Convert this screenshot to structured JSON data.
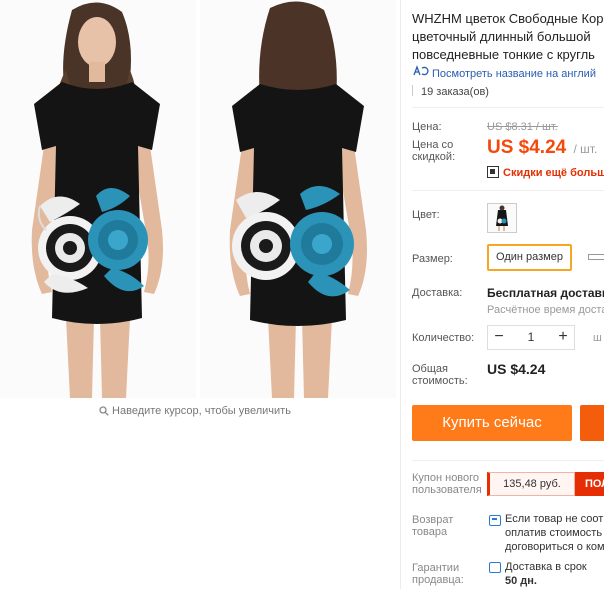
{
  "gallery": {
    "zoom_hint": "Наведите курсор, чтобы увеличить"
  },
  "product": {
    "title_lines": [
      "WHZHM цветок Свободные Кор",
      "цветочный длинный большой",
      "повседневные тонкие с кругль"
    ],
    "translate_link": "Посмотреть название на англий",
    "orders": "19 заказа(ов)"
  },
  "price": {
    "label": "Цена:",
    "old": "US $8.31 / шт.",
    "discount_label_1": "Цена со",
    "discount_label_2": "скидкой:",
    "new": "US $4.24",
    "unit": "/ шт.",
    "discount_link": "Скидки ещё больше"
  },
  "options": {
    "color_label": "Цвет:",
    "size_label": "Размер:",
    "size_value": "Один размер"
  },
  "shipping": {
    "label": "Доставка:",
    "free": "Бесплатная доставка",
    "time": "Расчётное время доставки"
  },
  "quantity": {
    "label": "Количество:",
    "minus": "−",
    "value": "1",
    "plus": "+",
    "more": "ш"
  },
  "total": {
    "label_1": "Общая",
    "label_2": "стоимость:",
    "value": "US $4.24"
  },
  "actions": {
    "buy_now": "Купить сейчас"
  },
  "coupon": {
    "label_1": "Купон нового",
    "label_2": "пользователя",
    "amount": "135,48 руб.",
    "get": "ПОЛ"
  },
  "returns": {
    "label_1": "Возврат",
    "label_2": "товара",
    "lines": [
      "Если товар не соотв",
      "оплатив стоимость",
      "договориться о ком"
    ]
  },
  "guarantee": {
    "label_1": "Гарантии",
    "label_2": "продавца:",
    "line_1": "Доставка в срок",
    "line_2": "50 дн."
  },
  "colors": {
    "accent_orange": "#ff7b1a",
    "price_red": "#f5490c",
    "link_blue": "#2a5db0",
    "dress_teal": "#2b93b8"
  }
}
